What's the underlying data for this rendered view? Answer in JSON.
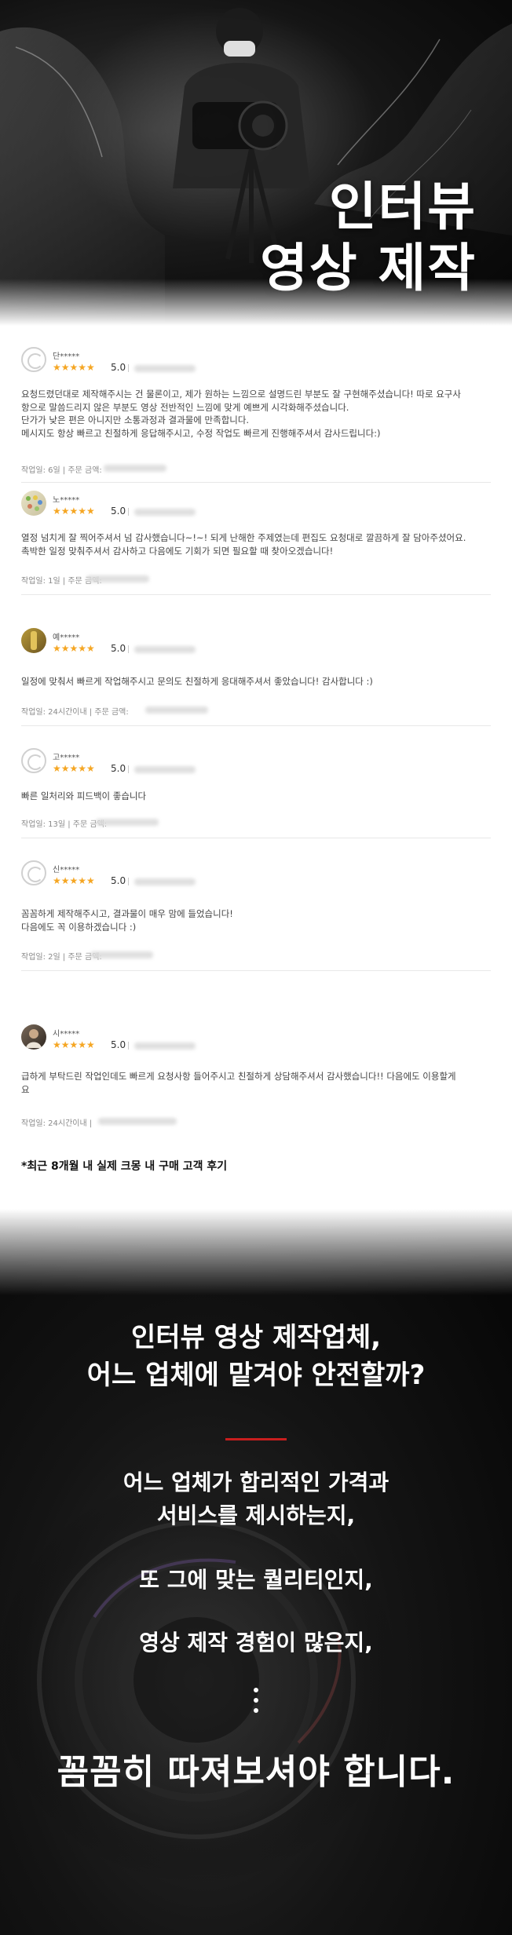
{
  "hero": {
    "title_line1": "인터뷰",
    "title_line2": "영상 제작"
  },
  "reviews": [
    {
      "name": "단*****",
      "stars": "★★★★★",
      "score": "5.0",
      "text": "요청드렸던대로 제작해주시는 건 물론이고, 제가 원하는 느낌으로 설명드린 부분도 잘 구현해주셨습니다! 따로 요구사\n항으로 말씀드리지 않은 부분도 영상 전반적인 느낌에 맞게 예쁘게 시각화해주셨습니다.\n단가가 낮은 편은 아니지만 소통과정과 결과물에 만족합니다.\n메시지도 항상 빠르고 친절하게 응답해주시고, 수정 작업도 빠르게 진행해주셔서 감사드립니다:)",
      "meta": "작업일: 6일 | 주문 금액:"
    },
    {
      "name": "노*****",
      "stars": "★★★★★",
      "score": "5.0",
      "text": "열정 넘치게 잘 찍어주셔서 넘 감사했습니다~!~! 되게 난해한 주제였는데 편집도 요청대로 깔끔하게 잘 담아주셨어요.\n촉박한 일정 맞춰주셔서 감사하고 다음에도 기회가 되면 필요할 때 찾아오겠습니다!",
      "meta": "작업일: 1일 | 주문 금액:"
    },
    {
      "name": "예*****",
      "stars": "★★★★★",
      "score": "5.0",
      "text": "일정에 맞춰서 빠르게 작업해주시고 문의도 친절하게 응대해주셔서 좋았습니다! 감사합니다 :)",
      "meta": "작업일: 24시간이내 | 주문 금액:"
    },
    {
      "name": "고*****",
      "stars": "★★★★★",
      "score": "5.0",
      "text": "빠른 일처리와 피드백이 좋습니다",
      "meta": "작업일: 13일 | 주문 금액:"
    },
    {
      "name": "신*****",
      "stars": "★★★★★",
      "score": "5.0",
      "text": "꼼꼼하게 제작해주시고, 결과물이 매우 맘에 들었습니다!\n다음에도 꼭 이용하겠습니다 :)",
      "meta": "작업일: 2일 | 주문 금액:"
    },
    {
      "name": "시*****",
      "stars": "★★★★★",
      "score": "5.0",
      "text": "급하게 부탁드린 작업인데도 빠르게 요청사항 들어주시고 친절하게 상담해주셔서 감사했습니다!! 다음에도 이용할게\n요",
      "meta": "작업일: 24시간이내 |"
    }
  ],
  "footnote": "*최근 8개월 내 실제 크몽 내 구매 고객 후기",
  "bottom": {
    "question_line1": "인터뷰 영상 제작업체,",
    "question_line2": "어느 업체에 맡겨야 안전할까?",
    "point1_line1": "어느 업체가 합리적인 가격과",
    "point1_line2": "서비스를 제시하는지,",
    "point2": "또 그에 맞는 퀄리티인지,",
    "point3": "영상 제작 경험이 많은지,",
    "final": "꼼꼼히 따져보셔야 합니다."
  },
  "colors": {
    "accent_red": "#c81e1e",
    "star": "#f5a623"
  }
}
